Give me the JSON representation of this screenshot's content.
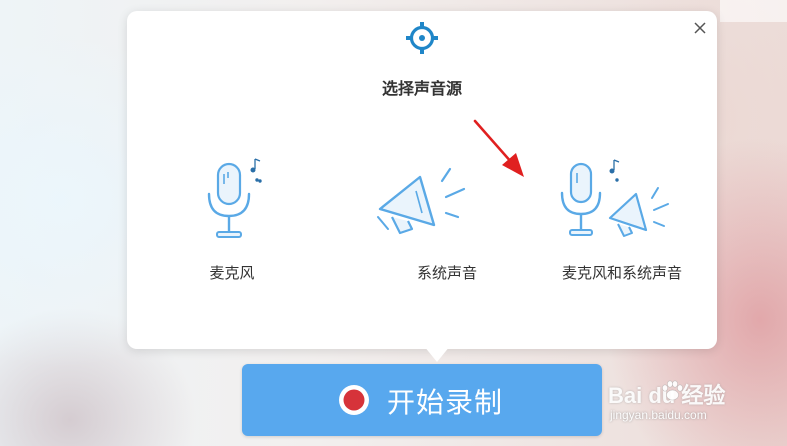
{
  "dialog": {
    "title": "选择声音源",
    "options": [
      {
        "label": "麦克风",
        "icon": "microphone-icon"
      },
      {
        "label": "系统声音",
        "icon": "speaker-icon"
      },
      {
        "label": "麦克风和系统声音",
        "icon": "microphone-speaker-icon"
      }
    ]
  },
  "record_button": {
    "label": "开始录制"
  },
  "watermark": {
    "brand": "Bai  du 经验",
    "url": "jingyan.baidu.com"
  },
  "colors": {
    "accent": "#58a8ee",
    "icon_blue": "#5aa9e6",
    "record_red": "#d6333a",
    "arrow_red": "#e02020"
  }
}
